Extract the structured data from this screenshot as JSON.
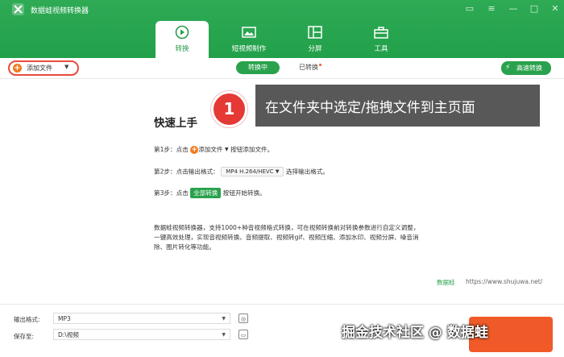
{
  "app": {
    "title": "数据蛙视频转换器"
  },
  "nav_tabs": [
    {
      "label": "转换",
      "icon": "convert-icon",
      "active": true
    },
    {
      "label": "短视频制作",
      "icon": "video-icon",
      "active": false
    },
    {
      "label": "分屏",
      "icon": "split-icon",
      "active": false
    },
    {
      "label": "工具",
      "icon": "toolbox-icon",
      "active": false
    }
  ],
  "toolbar": {
    "add_file": "添加文件",
    "converting": "转换中",
    "converted": "已转换",
    "fast_convert": "高速转换"
  },
  "callout": {
    "number": "1",
    "text": "在文件夹中选定/拖拽文件到主页面"
  },
  "quickstart": {
    "title": "快速上手",
    "step1_prefix": "第1步：点击",
    "step1_button": "添加文件",
    "step1_suffix": "按钮添加文件。",
    "step2_prefix": "第2步：点击输出格式：",
    "step2_format": "MP4 H.264/HEVC",
    "step2_suffix": "选择输出格式。",
    "step3_prefix": "第3步：点击",
    "step3_button": "全部转换",
    "step3_suffix": "按钮开始转换。",
    "description": "数据蛙视频转换器，支持1000+种音视频格式转换，可在视频转换前对转换参数进行自定义调整，一键高效处理，实现音视频转换、音频提取、视频转gif、视频压缩、添加水印、视频分屏、噪音消除、图片转化等功能。"
  },
  "watermark": {
    "logo_text": "数据蛙",
    "url": "https://www.shujuwa.net/"
  },
  "footer": {
    "output_format_label": "输出格式:",
    "output_format_value": "MP3",
    "save_to_label": "保存至:",
    "save_to_value": "D:\\视频"
  },
  "credit": "掘金技术社区 @ 数据蛙",
  "colors": {
    "brand_green": "#2aa24d",
    "accent_orange": "#f05a28",
    "callout_red": "#e53935"
  }
}
